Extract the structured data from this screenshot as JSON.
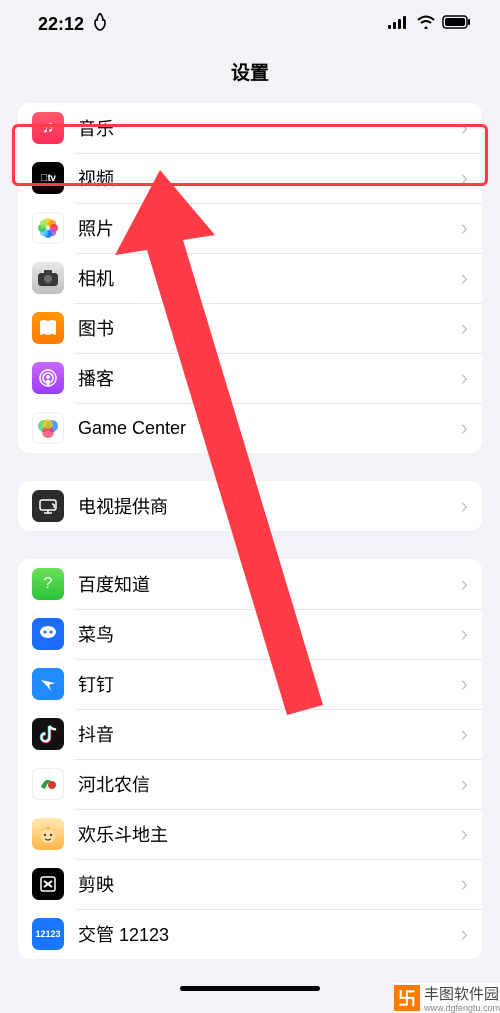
{
  "status": {
    "time": "22:12",
    "flame_icon": "flame-icon"
  },
  "title": "设置",
  "sections": [
    {
      "rows": [
        {
          "label": "音乐",
          "icon": "music-icon"
        },
        {
          "label": "视频",
          "icon": "tv-icon"
        },
        {
          "label": "照片",
          "icon": "photos-icon"
        },
        {
          "label": "相机",
          "icon": "camera-icon"
        },
        {
          "label": "图书",
          "icon": "books-icon"
        },
        {
          "label": "播客",
          "icon": "podcasts-icon"
        },
        {
          "label": "Game Center",
          "icon": "gamecenter-icon"
        }
      ]
    },
    {
      "rows": [
        {
          "label": "电视提供商",
          "icon": "tv-provider-icon"
        }
      ]
    },
    {
      "rows": [
        {
          "label": "百度知道",
          "icon": "baiduzhidao-icon"
        },
        {
          "label": "菜鸟",
          "icon": "cainiao-icon"
        },
        {
          "label": "钉钉",
          "icon": "dingding-icon"
        },
        {
          "label": "抖音",
          "icon": "douyin-icon"
        },
        {
          "label": "河北农信",
          "icon": "hebeinongxin-icon"
        },
        {
          "label": "欢乐斗地主",
          "icon": "huanledoudizhu-icon"
        },
        {
          "label": "剪映",
          "icon": "jianying-icon"
        },
        {
          "label": "交管 12123",
          "icon": "jiaoguan12123-icon"
        }
      ]
    }
  ],
  "annotation": {
    "highlighted_row": "音乐",
    "arrow_color": "#ff3b46"
  },
  "watermark": {
    "name": "丰图软件园",
    "url": "www.dgfengtu.com"
  }
}
